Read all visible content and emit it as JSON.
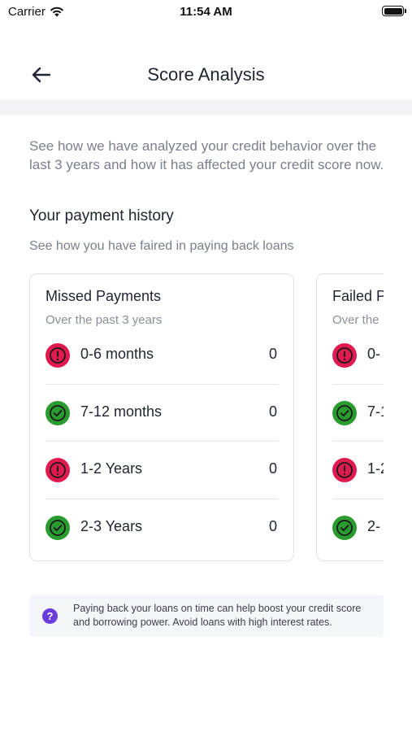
{
  "status_bar": {
    "carrier": "Carrier",
    "time": "11:54 AM",
    "battery_level": 1.0
  },
  "nav": {
    "back_icon": "arrow-left-icon",
    "title": "Score Analysis"
  },
  "intro": "See how we have analyzed your credit behavior over the last 3 years and how it has affected your credit score now.",
  "payment_history": {
    "title": "Your payment history",
    "subtitle": "See how you have faired in paying back loans"
  },
  "cards": [
    {
      "title": "Missed Payments",
      "subtitle": "Over the past 3 years",
      "rows": [
        {
          "label": "0-6 months",
          "value": "0",
          "status": "alert"
        },
        {
          "label": "7-12 months",
          "value": "0",
          "status": "ok"
        },
        {
          "label": "1-2 Years",
          "value": "0",
          "status": "alert"
        },
        {
          "label": "2-3 Years",
          "value": "0",
          "status": "ok"
        }
      ]
    },
    {
      "title": "Failed P",
      "subtitle": "Over the",
      "rows": [
        {
          "label": "0-",
          "status": "alert"
        },
        {
          "label": "7-1",
          "status": "ok"
        },
        {
          "label": "1-2",
          "status": "alert"
        },
        {
          "label": "2-",
          "status": "ok"
        }
      ]
    }
  ],
  "tip": {
    "icon": "question-icon",
    "icon_glyph": "?",
    "text": "Paying back your loans on time can help boost your credit score and borrowing power. Avoid loans with high interest rates."
  },
  "colors": {
    "alert": "#e0194f",
    "ok": "#2a9b2f",
    "accent": "#6b3ddb",
    "muted_text": "#7a7f8c"
  }
}
